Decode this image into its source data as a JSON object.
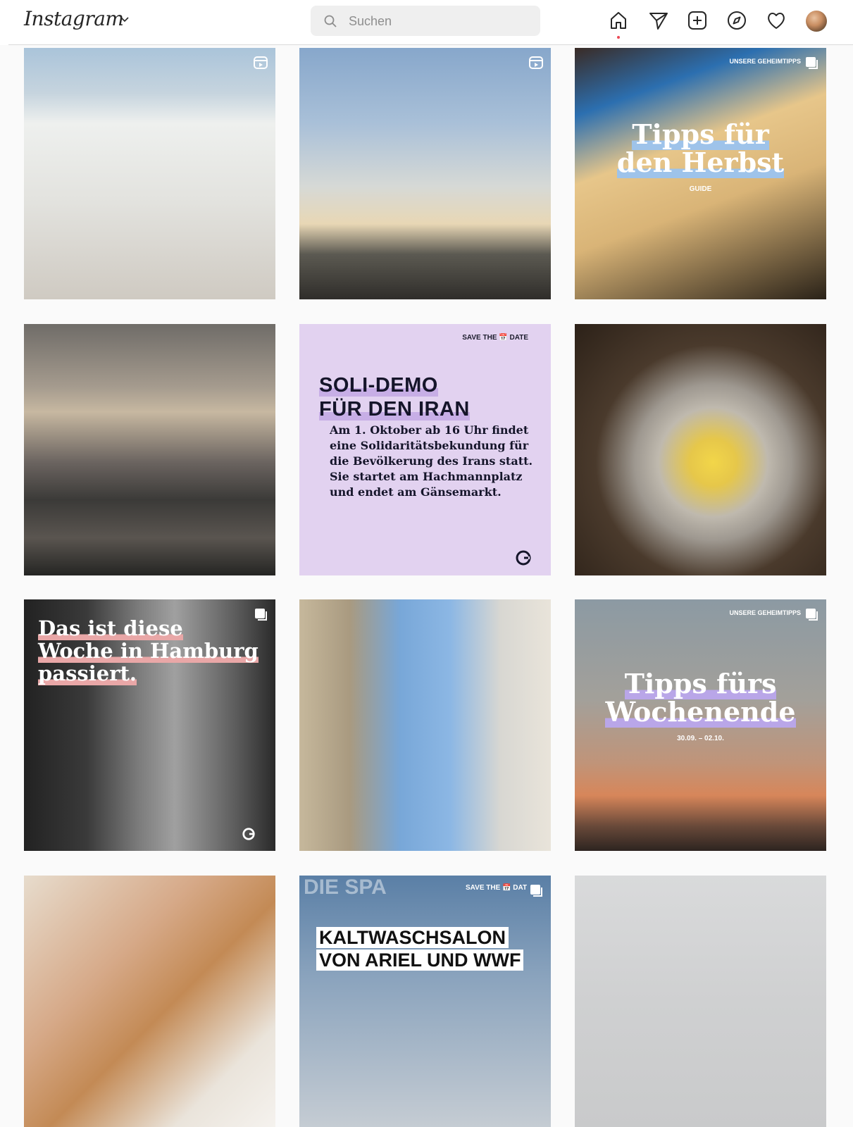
{
  "header": {
    "logo_text": "Instagram",
    "search": {
      "placeholder": "Suchen"
    },
    "nav_icons": [
      "home-icon",
      "send-icon",
      "new-post-icon",
      "explore-icon",
      "heart-icon",
      "profile-avatar"
    ]
  },
  "grid": {
    "posts": [
      {
        "id": "p1",
        "type": "reel",
        "text": ""
      },
      {
        "id": "p2",
        "type": "reel",
        "text": ""
      },
      {
        "id": "p3",
        "type": "carousel",
        "overlay_brand": "UNSERE GEHEIMTIPPS",
        "title_lines": [
          "Tipps für",
          "den Herbst"
        ],
        "subtitle": "GUIDE"
      },
      {
        "id": "p4",
        "type": "image",
        "text": ""
      },
      {
        "id": "p5",
        "type": "image",
        "save_the_date": "SAVE THE 📅 DATE",
        "title_lines": [
          "SOLI-DEMO",
          "FÜR DEN IRAN"
        ],
        "body_lines": [
          "Am 1. Oktober ab 16 Uhr findet",
          "eine Solidaritätsbekundung für",
          "die Bevölkerung des Irans statt.",
          "Sie startet am Hachmannplatz",
          "und endet am Gänsemarkt."
        ]
      },
      {
        "id": "p6",
        "type": "image",
        "text": ""
      },
      {
        "id": "p7",
        "type": "carousel",
        "title_lines": [
          "Das ist diese",
          "Woche in Hamburg",
          "passiert."
        ]
      },
      {
        "id": "p8",
        "type": "image",
        "text": ""
      },
      {
        "id": "p9",
        "type": "carousel",
        "overlay_brand": "UNSERE GEHEIMTIPPS",
        "title_lines": [
          "Tipps fürs",
          "Wochenende"
        ],
        "subtitle": "30.09. – 02.10."
      },
      {
        "id": "p10",
        "type": "image",
        "text": ""
      },
      {
        "id": "p11",
        "type": "carousel",
        "save_the_date": "SAVE THE 📅 DAT",
        "bg_text": "DIE SPA",
        "title_lines": [
          "KALTWASCHSALON",
          "VON ARIEL UND WWF"
        ]
      },
      {
        "id": "p12",
        "type": "image",
        "text": ""
      }
    ]
  },
  "colors": {
    "accent_dot": "#ed4956",
    "soli_bg": "#e2d2f0",
    "text_dark": "#262626"
  }
}
